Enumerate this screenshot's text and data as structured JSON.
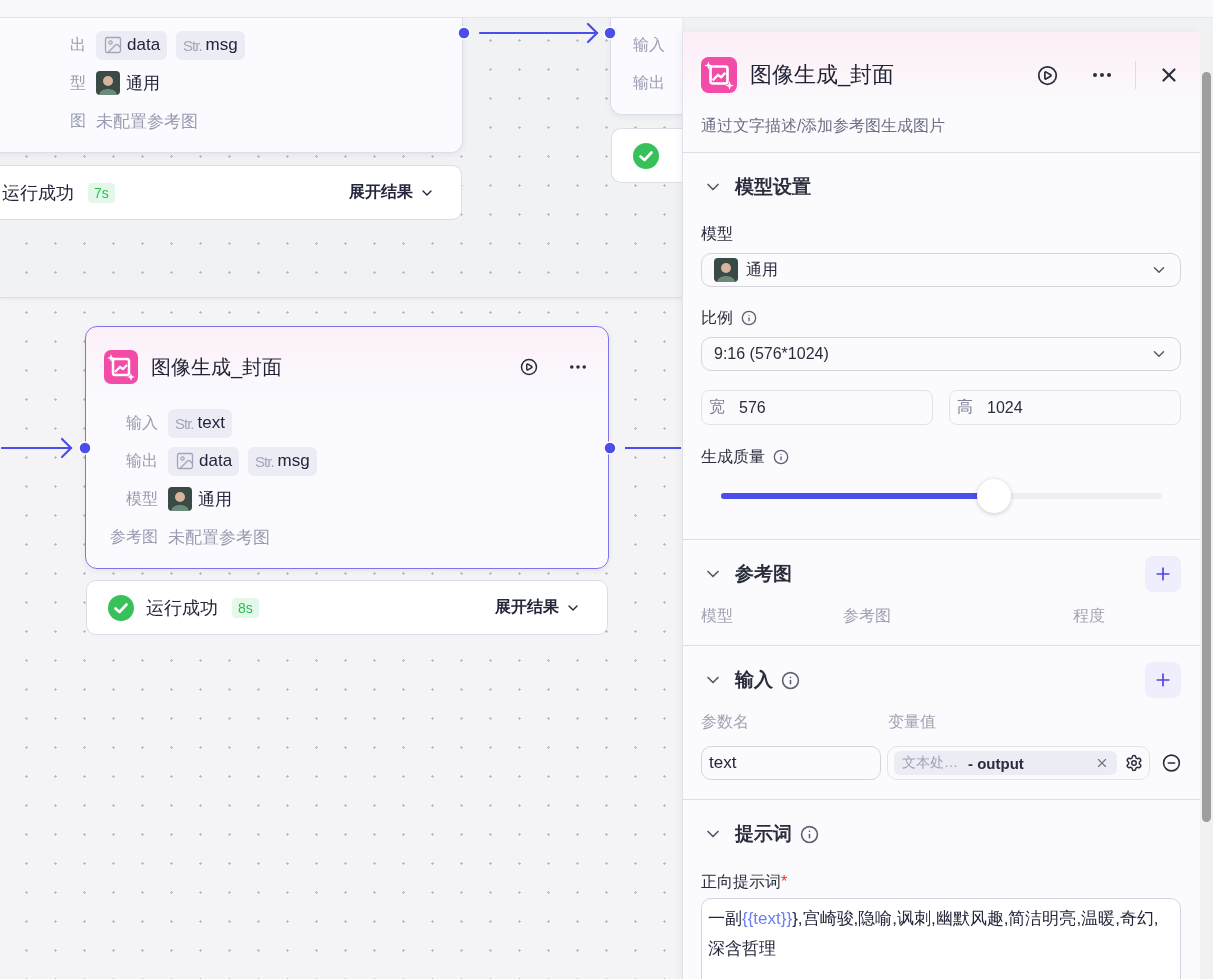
{
  "canvas": {
    "nodes": [
      {
        "selected": false,
        "rows": [
          {
            "label": "出",
            "kind": "chips",
            "chips": [
              {
                "kind": "image",
                "name": "data"
              },
              {
                "kind": "str",
                "prefix": "Str.",
                "name": "msg"
              }
            ]
          },
          {
            "label": "型",
            "kind": "model",
            "value": "通用"
          },
          {
            "label": "图",
            "kind": "text",
            "value": "未配置参考图"
          }
        ],
        "status": {
          "text": "运行成功",
          "time": "7s",
          "action": "展开结果"
        }
      },
      {
        "selected": false,
        "rows": [
          {
            "label": "输入",
            "kind": "label"
          },
          {
            "label": "输出",
            "kind": "label"
          }
        ],
        "status": {
          "kind": "success"
        }
      },
      {
        "selected": true,
        "title": "图像生成_封面",
        "rows": [
          {
            "label": "输入",
            "kind": "chips",
            "chips": [
              {
                "kind": "str",
                "prefix": "Str.",
                "name": "text"
              }
            ]
          },
          {
            "label": "输出",
            "kind": "chips",
            "chips": [
              {
                "kind": "image",
                "name": "data"
              },
              {
                "kind": "str",
                "prefix": "Str.",
                "name": "msg"
              }
            ]
          },
          {
            "label": "模型",
            "kind": "model",
            "value": "通用"
          },
          {
            "label": "参考图",
            "kind": "text",
            "value": "未配置参考图"
          }
        ],
        "status": {
          "kind": "success",
          "text": "运行成功",
          "time": "8s",
          "action": "展开结果"
        }
      }
    ]
  },
  "panel": {
    "title": "图像生成_封面",
    "subtitle": "通过文字描述/添加参考图生成图片",
    "sections": [
      {
        "kind": "model_settings",
        "title": "模型设置",
        "expanded": true,
        "info": false,
        "model": {
          "label": "模型",
          "value": "通用"
        },
        "ratio": {
          "label": "比例",
          "value": "9:16 (576*1024)"
        },
        "width": {
          "label": "宽",
          "value": "576"
        },
        "height": {
          "label": "高",
          "value": "1024"
        },
        "quality": {
          "label": "生成质量",
          "level": 0.62
        }
      },
      {
        "kind": "reference",
        "title": "参考图",
        "expanded": true,
        "info": false,
        "columns": [
          "模型",
          "参考图",
          "程度"
        ]
      },
      {
        "kind": "inputs",
        "title": "输入",
        "expanded": true,
        "info": true,
        "columns": [
          "参数名",
          "变量值"
        ],
        "rows": [
          {
            "name": "text",
            "source": "文本处…",
            "output": "- output"
          }
        ]
      },
      {
        "kind": "prompt",
        "title": "提示词",
        "expanded": true,
        "info": true,
        "label": "正向提示词",
        "required_mark": "*",
        "segments": [
          {
            "kind": "plain",
            "text": "一副"
          },
          {
            "kind": "variable",
            "text": "{{text}}"
          },
          {
            "kind": "plain",
            "text": "},宫崎骏,隐喻,讽刺,幽默风趣,简洁明亮,温暖,奇幻,深含哲理"
          }
        ]
      }
    ]
  }
}
